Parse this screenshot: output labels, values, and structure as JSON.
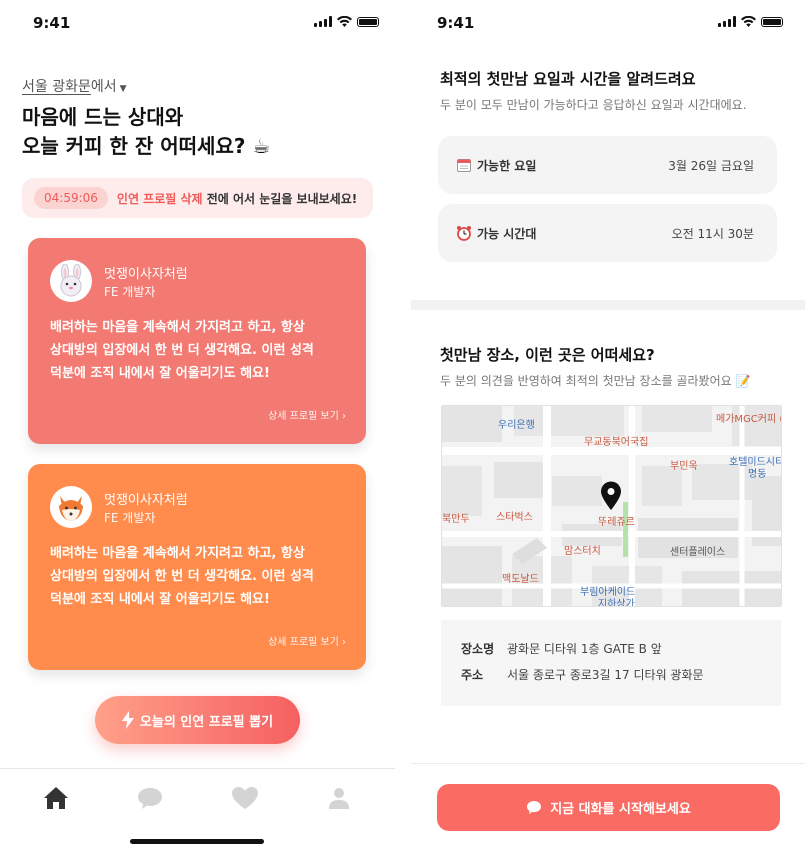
{
  "status": {
    "time": "9:41"
  },
  "left": {
    "location": {
      "place": "서울 광화문",
      "suffix": "에서"
    },
    "headline": {
      "line1": "마음에 드는 상대와",
      "line2": "오늘 커피 한 잔 어떠세요? ☕"
    },
    "notice": {
      "timer": "04:59:06",
      "highlight": "인연 프로필 삭제",
      "text": " 전에 어서 눈길을 보내보세요!"
    },
    "cards": [
      {
        "avatar_icon": "bunny-icon",
        "name": "멋쟁이사자처럼",
        "role": "FE 개발자",
        "bio": [
          "배려하는 마음을 계속해서 가지려고 하고, 항상",
          "상대방의 입장에서 한 번 더 생각해요. 이런 성격",
          "덕분에 조직 내에서 잘 어울리기도 해요!"
        ],
        "more": "상세 프로필 보기 ›",
        "color": "#f27a72"
      },
      {
        "avatar_icon": "fox-icon",
        "name": "멋쟁이사자처럼",
        "role": "FE 개발자",
        "bio": [
          "배려하는 마음을 계속해서 가지려고 하고, 항상",
          "상대방의 입장에서 한 번 더 생각해요. 이런 성격",
          "덕분에 조직 내에서 잘 어울리기도 해요!"
        ],
        "more": "상세 프로필 보기 ›",
        "color": "#ff8c4d"
      }
    ],
    "draw_button": "오늘의 인연 프로필 뽑기",
    "tabs": [
      "home-icon",
      "chat-icon",
      "heart-icon",
      "profile-icon"
    ]
  },
  "right": {
    "schedule": {
      "title": "최적의 첫만남 요일과 시간을 알려드려요",
      "subtitle": "두 분이 모두 만남이 가능하다고 응답하신 요일과 시간대에요.",
      "rows": [
        {
          "icon": "calendar-icon",
          "label": "가능한 요일",
          "value": "3월 26일 금요일"
        },
        {
          "icon": "alarm-clock-icon",
          "label": "가능 시간대",
          "value": "오전 11시 30분"
        }
      ]
    },
    "place": {
      "title": "첫만남 장소, 이런 곳은 어떠세요?",
      "subtitle": "두 분의 의견을 반영하여 최적의 첫만남 장소를 골라봤어요 📝",
      "map_labels": {
        "bank": "우리은행",
        "cinema": "메가MGC커피 (",
        "restaurant1": "무교동북어국집",
        "restaurant2": "부민옥",
        "hotel": "호텔미드시티",
        "hotel2": "명동",
        "dumpling": "북만두",
        "starbucks": "스타벅스",
        "target": "뚜레쥬르",
        "moms": "맘스터치",
        "center": "센터플레이스",
        "mcd": "맥도날드",
        "arcade": "부림아케이드",
        "arcade2": "지하상가"
      },
      "venue_name_key": "장소명",
      "venue_name": "광화문 디타워 1층 GATE B 앞",
      "address_key": "주소",
      "address": "서울 종로구 종로3길 17 디타워 광화문"
    },
    "chat_button": "지금 대화를 시작해보세요"
  }
}
